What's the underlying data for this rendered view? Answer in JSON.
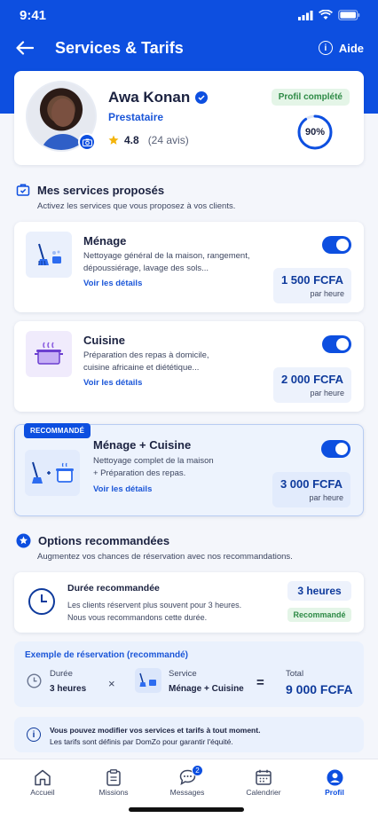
{
  "status_bar": {
    "time": "9:41"
  },
  "nav": {
    "title": "Services & Tarifs",
    "help_label": "Aide"
  },
  "profile": {
    "name": "Awa Konan",
    "role": "Prestataire",
    "rating": "4.8",
    "reviews": "(24 avis)",
    "status_badge": "Profil complété",
    "completion_label": "90%",
    "completion": 0.9
  },
  "services_section": {
    "title": "Mes services proposés",
    "subtitle": "Activez les services que vous proposez à vos clients."
  },
  "services": [
    {
      "name": "Ménage",
      "desc1": "Nettoyage général de la maison, rangement,",
      "desc2": "dépoussiérage, lavage des sols...",
      "link": "Voir les détails",
      "price": "1 500 FCFA",
      "unit": "par heure",
      "enabled": true
    },
    {
      "name": "Cuisine",
      "desc1": "Préparation des repas à domicile,",
      "desc2": "cuisine africaine et diététique...",
      "link": "Voir les détails",
      "price": "2 000 FCFA",
      "unit": "par heure",
      "enabled": true
    },
    {
      "name": "Ménage + Cuisine",
      "desc1": "Nettoyage complet de la maison",
      "desc2": "+ Préparation des repas.",
      "link": "Voir les détails",
      "price": "3 000 FCFA",
      "unit": "par heure",
      "enabled": true,
      "tag": "RECOMMANDÉ"
    }
  ],
  "options_section": {
    "title": "Options recommandées",
    "subtitle": "Augmentez vos chances de réservation avec nos recommandations."
  },
  "option": {
    "title": "Durée recommandée",
    "desc1": "Les clients réservent plus souvent pour 3 heures.",
    "desc2": "Nous vous recommandons cette durée.",
    "value": "3 heures",
    "badge": "Recommandé"
  },
  "example": {
    "title": "Exemple de réservation (recommandé)",
    "duration_label": "Durée",
    "duration_value": "3 heures",
    "multiply": "×",
    "service_label": "Service",
    "service_value": "Ménage + Cuisine",
    "equals": "=",
    "total_label": "Total",
    "total_value": "9 000 FCFA"
  },
  "info": {
    "line1": "Vous pouvez modifier vos services et tarifs à tout moment.",
    "line2": "Les tarifs sont définis par DomZo pour garantir l'équité."
  },
  "tabs": [
    {
      "label": "Accueil"
    },
    {
      "label": "Missions"
    },
    {
      "label": "Messages",
      "badge": "2"
    },
    {
      "label": "Calendrier"
    },
    {
      "label": "Profil",
      "active": true
    }
  ],
  "colors": {
    "primary": "#0d4fe0",
    "dark_blue": "#0e3a9c",
    "success": "#2d8a45"
  }
}
